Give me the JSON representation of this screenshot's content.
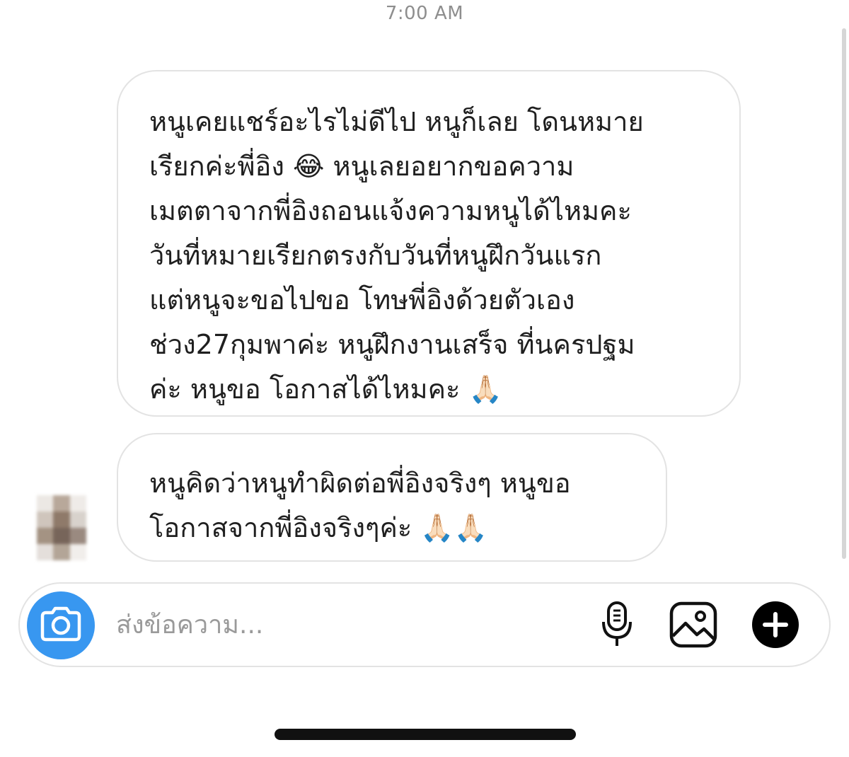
{
  "thread": {
    "timestamp": "7:00 AM",
    "messages": [
      {
        "lines": [
          "หนูเคยแชร์อะไรไม่ดีไป หนูก็เลย โดนหมาย",
          "เรียกค่ะพี่อิง 😂 หนูเลยอยากขอความ",
          "เมตตาจากพี่อิงถอนแจ้งความหนูได้ไหมคะ",
          "วันที่หมายเรียกตรงกับวันที่หนูฝึกวันแรก",
          "แต่หนูจะขอไปขอ โทษพี่อิงด้วยตัวเอง",
          "ช่วง27กุมพาค่ะ หนูฝึกงานเสร็จ ที่นครปฐม",
          "ค่ะ หนูขอ โอกาสได้ไหมคะ 🙏🏻"
        ]
      },
      {
        "lines": [
          "หนูคิดว่าหนูทำผิดต่อพี่อิงจริงๆ หนูขอ",
          "โอกาสจากพี่อิงจริงๆค่ะ 🙏🏻🙏🏻"
        ]
      }
    ]
  },
  "composer": {
    "placeholder": "ส่งข้อความ...",
    "value": "",
    "icons": {
      "camera": "camera-icon",
      "mic": "microphone-icon",
      "gallery": "image-gallery-icon",
      "plus": "plus-icon"
    },
    "accent_color": "#3897f0"
  },
  "colors": {
    "bubble_border": "#e3e3e3",
    "timestamp": "#8e8e8e",
    "home_indicator": "#111111"
  }
}
